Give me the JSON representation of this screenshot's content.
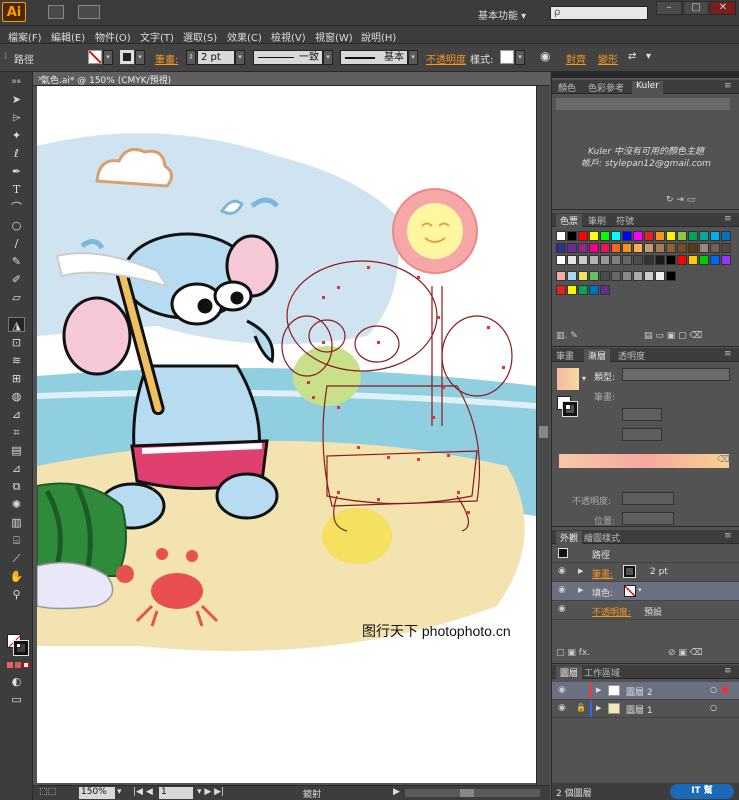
{
  "app": {
    "logo": "Ai",
    "workspace": "基本功能",
    "search_placeholder": "ρ"
  },
  "menu": [
    "檔案(F)",
    "編輯(E)",
    "物件(O)",
    "文字(T)",
    "選取(S)",
    "效果(C)",
    "檢視(V)",
    "視窗(W)",
    "說明(H)"
  ],
  "control": {
    "selection_label": "路徑",
    "stroke_label": "筆畫:",
    "stroke_weight": "2 pt",
    "stroke_profile": "一致",
    "brush": "基本",
    "opacity_label": "不透明度",
    "style_label": "樣式:",
    "align_label": "對齊",
    "transform_label": "變形"
  },
  "document": {
    "tab_title": "氣色.ai* @ 150% (CMYK/預視)",
    "watermark": "图行天下 photophoto.cn"
  },
  "status": {
    "zoom": "150%",
    "page": "1",
    "tool": "鏡射"
  },
  "panels": {
    "color_tabs": [
      "顏色",
      "色彩參考",
      "Kuler"
    ],
    "kuler_message": "Kuler 中沒有可用的顏色主題",
    "kuler_account": "帳戶: stylepan12@gmail.com",
    "swatch_tabs": [
      "色票",
      "筆刷",
      "符號"
    ],
    "gradient_tabs": [
      "筆畫",
      "漸層",
      "透明度"
    ],
    "gradient": {
      "type_label": "類型:",
      "stroke_label": "筆畫:",
      "opacity_label": "不透明度:",
      "position_label": "位置:"
    },
    "appearance_tabs": [
      "外觀",
      "繪圖樣式"
    ],
    "appearance": {
      "title": "路徑",
      "stroke_label": "筆畫:",
      "stroke_value": "2 pt",
      "fill_label": "填色:",
      "opacity_label": "不透明度:",
      "opacity_value": "預設",
      "fx_label": "fx."
    },
    "layer_tabs": [
      "圖層",
      "工作區域"
    ],
    "layers": [
      {
        "name": "圖層 2",
        "color": "#ff3333",
        "locked": false,
        "selected": true
      },
      {
        "name": "圖層 1",
        "color": "#3366ff",
        "locked": true,
        "selected": false
      }
    ],
    "layer_count": "2 個圖層"
  },
  "colors": {
    "accent": "#f7941d",
    "chrome_dark": "#3c3c3c",
    "panel": "#535353"
  }
}
